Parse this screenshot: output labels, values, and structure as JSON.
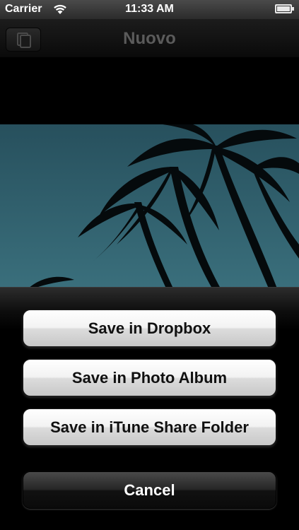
{
  "status_bar": {
    "carrier": "Carrier",
    "time": "11:33 AM",
    "wifi_icon": "wifi-icon",
    "battery_icon": "battery-icon"
  },
  "nav_bar": {
    "title": "Nuovo",
    "left_button_icon": "gallery-icon"
  },
  "photo": {
    "description_icon": "palm-trees-photo"
  },
  "action_sheet": {
    "buttons": [
      {
        "label": "Save in Dropbox"
      },
      {
        "label": "Save in Photo Album"
      },
      {
        "label": "Save in iTune Share Folder"
      }
    ],
    "cancel_label": "Cancel"
  },
  "colors": {
    "sheet_button_face": "#e8e8e8",
    "cancel_button_face": "#1a1a1a",
    "sky": "#2f5a66"
  }
}
